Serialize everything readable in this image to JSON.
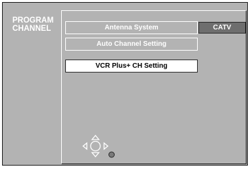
{
  "menu": {
    "title_line1": "PROGRAM",
    "title_line2": "CHANNEL"
  },
  "settings": [
    {
      "label": "Antenna System",
      "value": "CATV"
    },
    {
      "label": "Auto Channel Setting"
    },
    {
      "label": "VCR Plus+ CH Setting"
    }
  ],
  "icons": {
    "navigation": "dpad-navigation-icon",
    "enter": "enter-dot-icon"
  },
  "colors": {
    "background": "#b3b3b3",
    "value_box": "#6e6e6e",
    "selected": "#ffffff",
    "text_dim": "#ffffff",
    "text_selected": "#000000"
  }
}
